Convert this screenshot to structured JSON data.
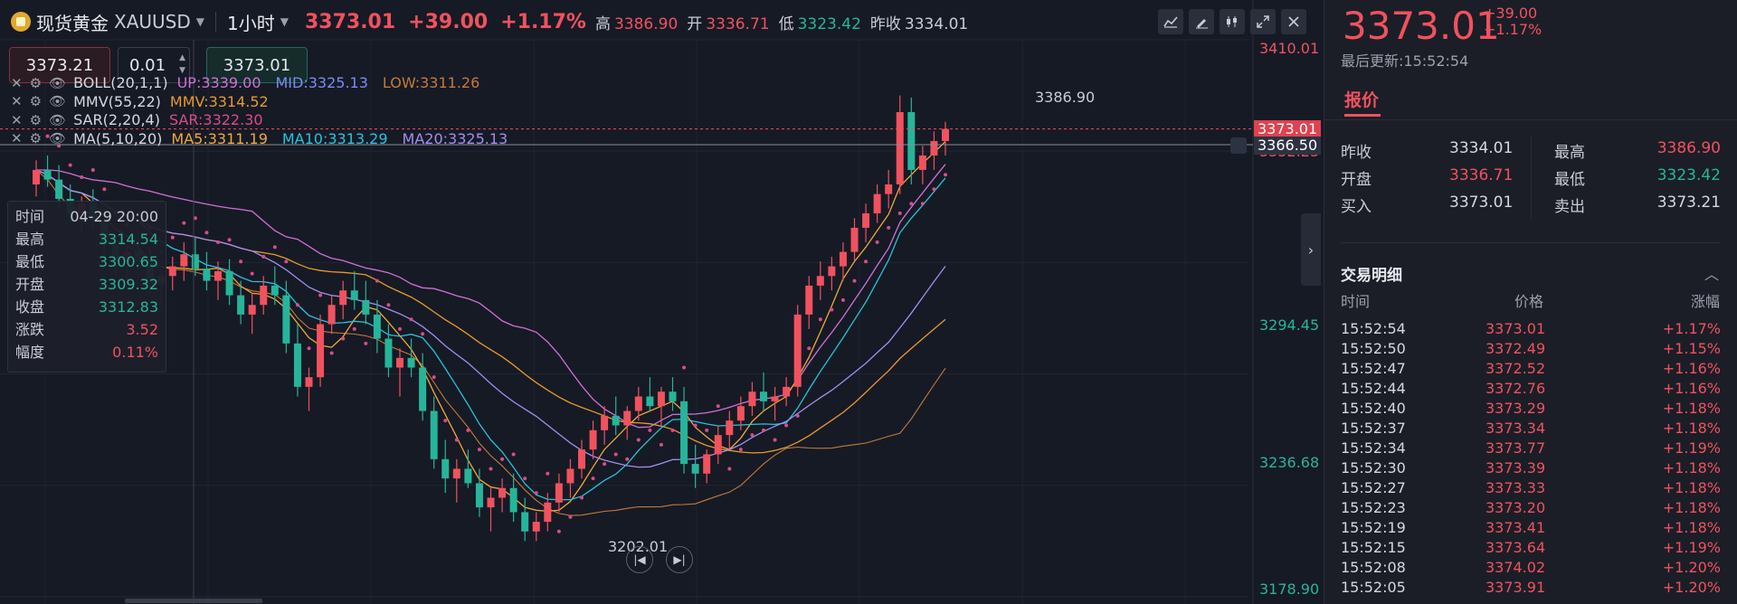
{
  "header": {
    "symbol_name": "现货黄金",
    "symbol_code": "XAUUSD",
    "period": "1小时",
    "last": "3373.01",
    "change": "+39.00",
    "change_pct": "+1.17%",
    "high_label": "高",
    "high": "3386.90",
    "open_label": "开",
    "open": "3336.71",
    "low_label": "低",
    "low": "3323.42",
    "prev_label": "昨收",
    "prev": "3334.01"
  },
  "toolbar": {
    "tools": [
      "chart-type-icon",
      "draw-icon",
      "indicator-icon",
      "fullscreen-icon",
      "close-icon"
    ]
  },
  "order": {
    "sell_price": "3373.21",
    "quantity": "0.01",
    "buy_price": "3373.01"
  },
  "indicators": [
    {
      "name": "BOLL(20,1,1)",
      "params": [
        {
          "text": "UP:3339.00",
          "color": "#d070d8"
        },
        {
          "text": "MID:3325.13",
          "color": "#7b8cf0"
        },
        {
          "text": "LOW:3311.26",
          "color": "#c47a3a"
        }
      ]
    },
    {
      "name": "MMV(55,22)",
      "params": [
        {
          "text": "MMV:3314.52",
          "color": "#e79a2e"
        }
      ]
    },
    {
      "name": "SAR(2,20,4)",
      "params": [
        {
          "text": "SAR:3322.30",
          "color": "#d84c8a"
        }
      ]
    },
    {
      "name": "MA(5,10,20)",
      "params": [
        {
          "text": "MA5:3311.19",
          "color": "#f2a83a"
        },
        {
          "text": "MA10:3313.29",
          "color": "#25c4dd"
        },
        {
          "text": "MA20:3325.13",
          "color": "#a58cf2"
        }
      ]
    }
  ],
  "crosshair_info": {
    "rows": [
      {
        "k": "时间",
        "v": "04-29 20:00",
        "color": "#c9ccd4"
      },
      {
        "k": "最高",
        "v": "3314.54",
        "color": "#26b59a"
      },
      {
        "k": "最低",
        "v": "3300.65",
        "color": "#26b59a"
      },
      {
        "k": "开盘",
        "v": "3309.32",
        "color": "#26b59a"
      },
      {
        "k": "收盘",
        "v": "3312.83",
        "color": "#26b59a"
      },
      {
        "k": "涨跌",
        "v": "3.52",
        "color": "#f0525e"
      },
      {
        "k": "幅度",
        "v": "0.11%",
        "color": "#f0525e"
      }
    ]
  },
  "y_axis": {
    "ticks": [
      {
        "label": "3410.01",
        "color": "#f0525e"
      },
      {
        "label": "3352.23",
        "color": "#f0525e"
      },
      {
        "label": "3294.45",
        "color": "#26b59a"
      },
      {
        "label": "3236.68",
        "color": "#26b59a"
      },
      {
        "label": "3178.90",
        "color": "#26b59a"
      }
    ],
    "last_tag": "3373.01",
    "cross_tag": "3366.50"
  },
  "annotations": {
    "high": "3386.90",
    "low": "3202.01"
  },
  "chart_data": {
    "type": "line",
    "ylim": [
      3178.9,
      3410.01
    ],
    "candles": [
      [
        3350,
        3360,
        3345,
        3356
      ],
      [
        3356,
        3362,
        3349,
        3352
      ],
      [
        3352,
        3358,
        3340,
        3344
      ],
      [
        3344,
        3350,
        3335,
        3338
      ],
      [
        3338,
        3345,
        3330,
        3342
      ],
      [
        3342,
        3348,
        3332,
        3335
      ],
      [
        3335,
        3340,
        3320,
        3325
      ],
      [
        3325,
        3330,
        3312,
        3318
      ],
      [
        3318,
        3325,
        3308,
        3322
      ],
      [
        3322,
        3330,
        3316,
        3318
      ],
      [
        3318,
        3324,
        3305,
        3309
      ],
      [
        3309,
        3314,
        3300,
        3312
      ],
      [
        3312,
        3320,
        3306,
        3316
      ],
      [
        3316,
        3326,
        3310,
        3321
      ],
      [
        3321,
        3328,
        3312,
        3315
      ],
      [
        3315,
        3322,
        3306,
        3310
      ],
      [
        3310,
        3318,
        3302,
        3314
      ],
      [
        3314,
        3319,
        3300,
        3304
      ],
      [
        3304,
        3310,
        3292,
        3296
      ],
      [
        3296,
        3305,
        3288,
        3300
      ],
      [
        3300,
        3312,
        3296,
        3308
      ],
      [
        3308,
        3316,
        3300,
        3304
      ],
      [
        3304,
        3310,
        3280,
        3284
      ],
      [
        3284,
        3292,
        3262,
        3266
      ],
      [
        3266,
        3274,
        3256,
        3270
      ],
      [
        3270,
        3296,
        3266,
        3292
      ],
      [
        3292,
        3304,
        3288,
        3300
      ],
      [
        3300,
        3310,
        3294,
        3306
      ],
      [
        3306,
        3314,
        3298,
        3302
      ],
      [
        3302,
        3310,
        3292,
        3296
      ],
      [
        3296,
        3302,
        3280,
        3286
      ],
      [
        3286,
        3292,
        3270,
        3274
      ],
      [
        3274,
        3282,
        3262,
        3278
      ],
      [
        3278,
        3286,
        3270,
        3274
      ],
      [
        3274,
        3280,
        3252,
        3256
      ],
      [
        3256,
        3262,
        3232,
        3236
      ],
      [
        3236,
        3244,
        3222,
        3228
      ],
      [
        3228,
        3236,
        3218,
        3232
      ],
      [
        3232,
        3240,
        3224,
        3226
      ],
      [
        3226,
        3232,
        3212,
        3216
      ],
      [
        3216,
        3224,
        3206,
        3220
      ],
      [
        3220,
        3228,
        3214,
        3224
      ],
      [
        3224,
        3230,
        3210,
        3214
      ],
      [
        3214,
        3220,
        3202,
        3206
      ],
      [
        3206,
        3214,
        3202,
        3210
      ],
      [
        3210,
        3222,
        3206,
        3218
      ],
      [
        3218,
        3230,
        3214,
        3226
      ],
      [
        3226,
        3236,
        3220,
        3232
      ],
      [
        3232,
        3244,
        3228,
        3240
      ],
      [
        3240,
        3252,
        3236,
        3248
      ],
      [
        3248,
        3258,
        3242,
        3254
      ],
      [
        3254,
        3262,
        3246,
        3250
      ],
      [
        3250,
        3258,
        3244,
        3256
      ],
      [
        3256,
        3266,
        3252,
        3262
      ],
      [
        3262,
        3270,
        3256,
        3258
      ],
      [
        3258,
        3266,
        3250,
        3264
      ],
      [
        3264,
        3270,
        3256,
        3260
      ],
      [
        3260,
        3266,
        3230,
        3234
      ],
      [
        3234,
        3242,
        3224,
        3230
      ],
      [
        3230,
        3240,
        3226,
        3238
      ],
      [
        3238,
        3250,
        3234,
        3246
      ],
      [
        3246,
        3256,
        3240,
        3252
      ],
      [
        3252,
        3262,
        3248,
        3258
      ],
      [
        3258,
        3268,
        3254,
        3264
      ],
      [
        3264,
        3272,
        3256,
        3260
      ],
      [
        3260,
        3266,
        3252,
        3262
      ],
      [
        3262,
        3270,
        3258,
        3266
      ],
      [
        3266,
        3300,
        3262,
        3296
      ],
      [
        3296,
        3312,
        3290,
        3308
      ],
      [
        3308,
        3318,
        3302,
        3312
      ],
      [
        3312,
        3320,
        3306,
        3316
      ],
      [
        3316,
        3326,
        3310,
        3322
      ],
      [
        3322,
        3336,
        3318,
        3332
      ],
      [
        3332,
        3342,
        3326,
        3338
      ],
      [
        3338,
        3350,
        3334,
        3346
      ],
      [
        3346,
        3356,
        3340,
        3350
      ],
      [
        3350,
        3386.9,
        3346,
        3380
      ],
      [
        3380,
        3386,
        3350,
        3356
      ],
      [
        3356,
        3366,
        3350,
        3362
      ],
      [
        3362,
        3372,
        3356,
        3368
      ],
      [
        3368,
        3376,
        3362,
        3373.01
      ]
    ]
  },
  "right_panel": {
    "price": "3373.01",
    "change": "+39.00",
    "change_pct": "+1.17%",
    "updated": "最后更新:15:52:54",
    "tab": "报价",
    "quote": [
      {
        "l": "昨收",
        "lv": "3334.01",
        "lc": "#d6d8de",
        "r": "最高",
        "rv": "3386.90",
        "rc": "#f0525e"
      },
      {
        "l": "开盘",
        "lv": "3336.71",
        "lc": "#f0525e",
        "r": "最低",
        "rv": "3323.42",
        "rc": "#26b59a"
      },
      {
        "l": "买入",
        "lv": "3373.01",
        "lc": "#d6d8de",
        "r": "卖出",
        "rv": "3373.21",
        "rc": "#d6d8de"
      }
    ],
    "trades_title": "交易明细",
    "headers": {
      "time": "时间",
      "price": "价格",
      "pct": "涨幅"
    },
    "trades": [
      {
        "t": "15:52:54",
        "p": "3373.01",
        "c": "+1.17%"
      },
      {
        "t": "15:52:50",
        "p": "3372.49",
        "c": "+1.15%"
      },
      {
        "t": "15:52:47",
        "p": "3372.52",
        "c": "+1.16%"
      },
      {
        "t": "15:52:44",
        "p": "3372.76",
        "c": "+1.16%"
      },
      {
        "t": "15:52:40",
        "p": "3373.29",
        "c": "+1.18%"
      },
      {
        "t": "15:52:37",
        "p": "3373.34",
        "c": "+1.18%"
      },
      {
        "t": "15:52:34",
        "p": "3373.77",
        "c": "+1.19%"
      },
      {
        "t": "15:52:30",
        "p": "3373.39",
        "c": "+1.18%"
      },
      {
        "t": "15:52:27",
        "p": "3373.33",
        "c": "+1.18%"
      },
      {
        "t": "15:52:23",
        "p": "3373.20",
        "c": "+1.18%"
      },
      {
        "t": "15:52:19",
        "p": "3373.41",
        "c": "+1.18%"
      },
      {
        "t": "15:52:15",
        "p": "3373.64",
        "c": "+1.19%"
      },
      {
        "t": "15:52:08",
        "p": "3374.02",
        "c": "+1.20%"
      },
      {
        "t": "15:52:05",
        "p": "3373.91",
        "c": "+1.20%"
      }
    ]
  }
}
